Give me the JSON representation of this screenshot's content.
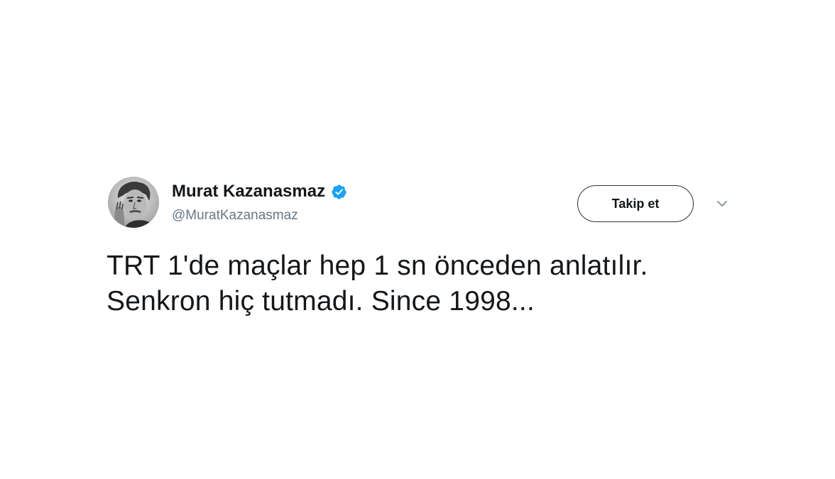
{
  "author": {
    "display_name": "Murat Kazanasmaz",
    "handle": "@MuratKazanasmaz",
    "verified": true,
    "avatar_icon": "profile-photo"
  },
  "actions": {
    "follow_label": "Takip et",
    "more_icon": "chevron-down-icon"
  },
  "tweet": {
    "lines": [
      "TRT 1'de maçlar hep 1 sn önceden anlatılır.",
      "Senkron hiç tutmadı. Since 1998..."
    ]
  },
  "colors": {
    "verified_blue": "#1da1f2",
    "handle_gray": "#657786",
    "text": "#14171a"
  }
}
